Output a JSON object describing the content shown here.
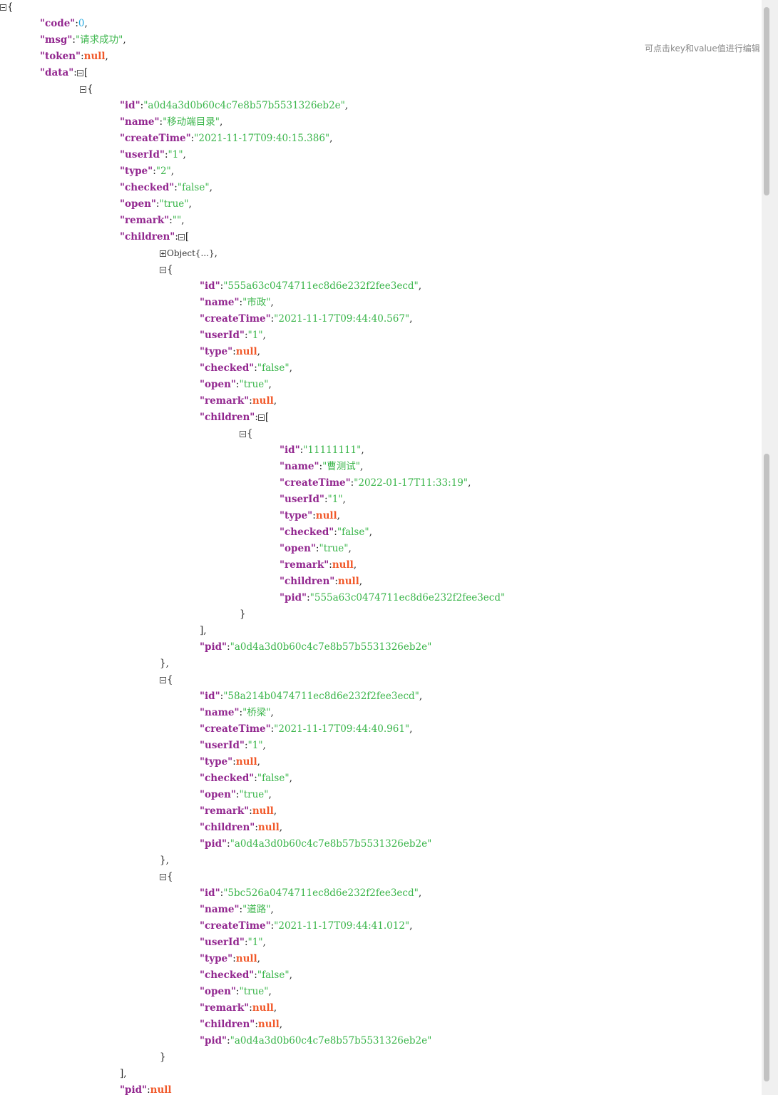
{
  "hint": "可点击key和value值进行编辑",
  "collapsed_label": "Object{...}",
  "lines": [
    {
      "indent": 0,
      "tog": "minus",
      "parts": [
        [
          "p",
          "{"
        ]
      ]
    },
    {
      "indent": 1,
      "parts": [
        [
          "k",
          "\"code\""
        ],
        [
          "p",
          ":"
        ],
        [
          "n",
          "0"
        ],
        [
          "p",
          ","
        ]
      ]
    },
    {
      "indent": 1,
      "parts": [
        [
          "k",
          "\"msg\""
        ],
        [
          "p",
          ":"
        ],
        [
          "s",
          "\"请求成功\""
        ],
        [
          "p",
          ","
        ]
      ]
    },
    {
      "indent": 1,
      "parts": [
        [
          "k",
          "\"token\""
        ],
        [
          "p",
          ":"
        ],
        [
          "nl",
          "null"
        ],
        [
          "p",
          ","
        ]
      ]
    },
    {
      "indent": 1,
      "parts": [
        [
          "k",
          "\"data\""
        ],
        [
          "p",
          ":"
        ],
        [
          "tog",
          "minus"
        ],
        [
          "p",
          "["
        ]
      ]
    },
    {
      "indent": 2,
      "parts": [
        [
          "tog",
          "minus"
        ],
        [
          "p",
          "{"
        ]
      ]
    },
    {
      "indent": 3,
      "parts": [
        [
          "k",
          "\"id\""
        ],
        [
          "p",
          ":"
        ],
        [
          "s",
          "\"a0d4a3d0b60c4c7e8b57b5531326eb2e\""
        ],
        [
          "p",
          ","
        ]
      ]
    },
    {
      "indent": 3,
      "parts": [
        [
          "k",
          "\"name\""
        ],
        [
          "p",
          ":"
        ],
        [
          "s",
          "\"移动端目录\""
        ],
        [
          "p",
          ","
        ]
      ]
    },
    {
      "indent": 3,
      "parts": [
        [
          "k",
          "\"createTime\""
        ],
        [
          "p",
          ":"
        ],
        [
          "s",
          "\"2021-11-17T09:40:15.386\""
        ],
        [
          "p",
          ","
        ]
      ]
    },
    {
      "indent": 3,
      "parts": [
        [
          "k",
          "\"userId\""
        ],
        [
          "p",
          ":"
        ],
        [
          "s",
          "\"1\""
        ],
        [
          "p",
          ","
        ]
      ]
    },
    {
      "indent": 3,
      "parts": [
        [
          "k",
          "\"type\""
        ],
        [
          "p",
          ":"
        ],
        [
          "s",
          "\"2\""
        ],
        [
          "p",
          ","
        ]
      ]
    },
    {
      "indent": 3,
      "parts": [
        [
          "k",
          "\"checked\""
        ],
        [
          "p",
          ":"
        ],
        [
          "s",
          "\"false\""
        ],
        [
          "p",
          ","
        ]
      ]
    },
    {
      "indent": 3,
      "parts": [
        [
          "k",
          "\"open\""
        ],
        [
          "p",
          ":"
        ],
        [
          "s",
          "\"true\""
        ],
        [
          "p",
          ","
        ]
      ]
    },
    {
      "indent": 3,
      "parts": [
        [
          "k",
          "\"remark\""
        ],
        [
          "p",
          ":"
        ],
        [
          "s",
          "\"\""
        ],
        [
          "p",
          ","
        ]
      ]
    },
    {
      "indent": 3,
      "parts": [
        [
          "k",
          "\"children\""
        ],
        [
          "p",
          ":"
        ],
        [
          "tog",
          "minus"
        ],
        [
          "p",
          "["
        ]
      ]
    },
    {
      "indent": 4,
      "parts": [
        [
          "tog",
          "plus"
        ],
        [
          "c",
          "Object{...}"
        ],
        [
          "p",
          ","
        ]
      ]
    },
    {
      "indent": 4,
      "parts": [
        [
          "tog",
          "minus"
        ],
        [
          "p",
          "{"
        ]
      ]
    },
    {
      "indent": 5,
      "parts": [
        [
          "k",
          "\"id\""
        ],
        [
          "p",
          ":"
        ],
        [
          "s",
          "\"555a63c0474711ec8d6e232f2fee3ecd\""
        ],
        [
          "p",
          ","
        ]
      ]
    },
    {
      "indent": 5,
      "parts": [
        [
          "k",
          "\"name\""
        ],
        [
          "p",
          ":"
        ],
        [
          "s",
          "\"市政\""
        ],
        [
          "p",
          ","
        ]
      ]
    },
    {
      "indent": 5,
      "parts": [
        [
          "k",
          "\"createTime\""
        ],
        [
          "p",
          ":"
        ],
        [
          "s",
          "\"2021-11-17T09:44:40.567\""
        ],
        [
          "p",
          ","
        ]
      ]
    },
    {
      "indent": 5,
      "parts": [
        [
          "k",
          "\"userId\""
        ],
        [
          "p",
          ":"
        ],
        [
          "s",
          "\"1\""
        ],
        [
          "p",
          ","
        ]
      ]
    },
    {
      "indent": 5,
      "parts": [
        [
          "k",
          "\"type\""
        ],
        [
          "p",
          ":"
        ],
        [
          "nl",
          "null"
        ],
        [
          "p",
          ","
        ]
      ]
    },
    {
      "indent": 5,
      "parts": [
        [
          "k",
          "\"checked\""
        ],
        [
          "p",
          ":"
        ],
        [
          "s",
          "\"false\""
        ],
        [
          "p",
          ","
        ]
      ]
    },
    {
      "indent": 5,
      "parts": [
        [
          "k",
          "\"open\""
        ],
        [
          "p",
          ":"
        ],
        [
          "s",
          "\"true\""
        ],
        [
          "p",
          ","
        ]
      ]
    },
    {
      "indent": 5,
      "parts": [
        [
          "k",
          "\"remark\""
        ],
        [
          "p",
          ":"
        ],
        [
          "nl",
          "null"
        ],
        [
          "p",
          ","
        ]
      ]
    },
    {
      "indent": 5,
      "parts": [
        [
          "k",
          "\"children\""
        ],
        [
          "p",
          ":"
        ],
        [
          "tog",
          "minus"
        ],
        [
          "p",
          "["
        ]
      ]
    },
    {
      "indent": 6,
      "parts": [
        [
          "tog",
          "minus"
        ],
        [
          "p",
          "{"
        ]
      ]
    },
    {
      "indent": 7,
      "parts": [
        [
          "k",
          "\"id\""
        ],
        [
          "p",
          ":"
        ],
        [
          "s",
          "\"11111111\""
        ],
        [
          "p",
          ","
        ]
      ]
    },
    {
      "indent": 7,
      "parts": [
        [
          "k",
          "\"name\""
        ],
        [
          "p",
          ":"
        ],
        [
          "s",
          "\"曹测试\""
        ],
        [
          "p",
          ","
        ]
      ]
    },
    {
      "indent": 7,
      "parts": [
        [
          "k",
          "\"createTime\""
        ],
        [
          "p",
          ":"
        ],
        [
          "s",
          "\"2022-01-17T11:33:19\""
        ],
        [
          "p",
          ","
        ]
      ]
    },
    {
      "indent": 7,
      "parts": [
        [
          "k",
          "\"userId\""
        ],
        [
          "p",
          ":"
        ],
        [
          "s",
          "\"1\""
        ],
        [
          "p",
          ","
        ]
      ]
    },
    {
      "indent": 7,
      "parts": [
        [
          "k",
          "\"type\""
        ],
        [
          "p",
          ":"
        ],
        [
          "nl",
          "null"
        ],
        [
          "p",
          ","
        ]
      ]
    },
    {
      "indent": 7,
      "parts": [
        [
          "k",
          "\"checked\""
        ],
        [
          "p",
          ":"
        ],
        [
          "s",
          "\"false\""
        ],
        [
          "p",
          ","
        ]
      ]
    },
    {
      "indent": 7,
      "parts": [
        [
          "k",
          "\"open\""
        ],
        [
          "p",
          ":"
        ],
        [
          "s",
          "\"true\""
        ],
        [
          "p",
          ","
        ]
      ]
    },
    {
      "indent": 7,
      "parts": [
        [
          "k",
          "\"remark\""
        ],
        [
          "p",
          ":"
        ],
        [
          "nl",
          "null"
        ],
        [
          "p",
          ","
        ]
      ]
    },
    {
      "indent": 7,
      "parts": [
        [
          "k",
          "\"children\""
        ],
        [
          "p",
          ":"
        ],
        [
          "nl",
          "null"
        ],
        [
          "p",
          ","
        ]
      ]
    },
    {
      "indent": 7,
      "parts": [
        [
          "k",
          "\"pid\""
        ],
        [
          "p",
          ":"
        ],
        [
          "s",
          "\"555a63c0474711ec8d6e232f2fee3ecd\""
        ]
      ]
    },
    {
      "indent": 6,
      "parts": [
        [
          "p",
          "}"
        ]
      ]
    },
    {
      "indent": 5,
      "parts": [
        [
          "p",
          "],"
        ]
      ]
    },
    {
      "indent": 5,
      "parts": [
        [
          "k",
          "\"pid\""
        ],
        [
          "p",
          ":"
        ],
        [
          "s",
          "\"a0d4a3d0b60c4c7e8b57b5531326eb2e\""
        ]
      ]
    },
    {
      "indent": 4,
      "parts": [
        [
          "p",
          "},"
        ]
      ]
    },
    {
      "indent": 4,
      "parts": [
        [
          "tog",
          "minus"
        ],
        [
          "p",
          "{"
        ]
      ]
    },
    {
      "indent": 5,
      "parts": [
        [
          "k",
          "\"id\""
        ],
        [
          "p",
          ":"
        ],
        [
          "s",
          "\"58a214b0474711ec8d6e232f2fee3ecd\""
        ],
        [
          "p",
          ","
        ]
      ]
    },
    {
      "indent": 5,
      "parts": [
        [
          "k",
          "\"name\""
        ],
        [
          "p",
          ":"
        ],
        [
          "s",
          "\"桥梁\""
        ],
        [
          "p",
          ","
        ]
      ]
    },
    {
      "indent": 5,
      "parts": [
        [
          "k",
          "\"createTime\""
        ],
        [
          "p",
          ":"
        ],
        [
          "s",
          "\"2021-11-17T09:44:40.961\""
        ],
        [
          "p",
          ","
        ]
      ]
    },
    {
      "indent": 5,
      "parts": [
        [
          "k",
          "\"userId\""
        ],
        [
          "p",
          ":"
        ],
        [
          "s",
          "\"1\""
        ],
        [
          "p",
          ","
        ]
      ]
    },
    {
      "indent": 5,
      "parts": [
        [
          "k",
          "\"type\""
        ],
        [
          "p",
          ":"
        ],
        [
          "nl",
          "null"
        ],
        [
          "p",
          ","
        ]
      ]
    },
    {
      "indent": 5,
      "parts": [
        [
          "k",
          "\"checked\""
        ],
        [
          "p",
          ":"
        ],
        [
          "s",
          "\"false\""
        ],
        [
          "p",
          ","
        ]
      ]
    },
    {
      "indent": 5,
      "parts": [
        [
          "k",
          "\"open\""
        ],
        [
          "p",
          ":"
        ],
        [
          "s",
          "\"true\""
        ],
        [
          "p",
          ","
        ]
      ]
    },
    {
      "indent": 5,
      "parts": [
        [
          "k",
          "\"remark\""
        ],
        [
          "p",
          ":"
        ],
        [
          "nl",
          "null"
        ],
        [
          "p",
          ","
        ]
      ]
    },
    {
      "indent": 5,
      "parts": [
        [
          "k",
          "\"children\""
        ],
        [
          "p",
          ":"
        ],
        [
          "nl",
          "null"
        ],
        [
          "p",
          ","
        ]
      ]
    },
    {
      "indent": 5,
      "parts": [
        [
          "k",
          "\"pid\""
        ],
        [
          "p",
          ":"
        ],
        [
          "s",
          "\"a0d4a3d0b60c4c7e8b57b5531326eb2e\""
        ]
      ]
    },
    {
      "indent": 4,
      "parts": [
        [
          "p",
          "},"
        ]
      ]
    },
    {
      "indent": 4,
      "parts": [
        [
          "tog",
          "minus"
        ],
        [
          "p",
          "{"
        ]
      ]
    },
    {
      "indent": 5,
      "parts": [
        [
          "k",
          "\"id\""
        ],
        [
          "p",
          ":"
        ],
        [
          "s",
          "\"5bc526a0474711ec8d6e232f2fee3ecd\""
        ],
        [
          "p",
          ","
        ]
      ]
    },
    {
      "indent": 5,
      "parts": [
        [
          "k",
          "\"name\""
        ],
        [
          "p",
          ":"
        ],
        [
          "s",
          "\"道路\""
        ],
        [
          "p",
          ","
        ]
      ]
    },
    {
      "indent": 5,
      "parts": [
        [
          "k",
          "\"createTime\""
        ],
        [
          "p",
          ":"
        ],
        [
          "s",
          "\"2021-11-17T09:44:41.012\""
        ],
        [
          "p",
          ","
        ]
      ]
    },
    {
      "indent": 5,
      "parts": [
        [
          "k",
          "\"userId\""
        ],
        [
          "p",
          ":"
        ],
        [
          "s",
          "\"1\""
        ],
        [
          "p",
          ","
        ]
      ]
    },
    {
      "indent": 5,
      "parts": [
        [
          "k",
          "\"type\""
        ],
        [
          "p",
          ":"
        ],
        [
          "nl",
          "null"
        ],
        [
          "p",
          ","
        ]
      ]
    },
    {
      "indent": 5,
      "parts": [
        [
          "k",
          "\"checked\""
        ],
        [
          "p",
          ":"
        ],
        [
          "s",
          "\"false\""
        ],
        [
          "p",
          ","
        ]
      ]
    },
    {
      "indent": 5,
      "parts": [
        [
          "k",
          "\"open\""
        ],
        [
          "p",
          ":"
        ],
        [
          "s",
          "\"true\""
        ],
        [
          "p",
          ","
        ]
      ]
    },
    {
      "indent": 5,
      "parts": [
        [
          "k",
          "\"remark\""
        ],
        [
          "p",
          ":"
        ],
        [
          "nl",
          "null"
        ],
        [
          "p",
          ","
        ]
      ]
    },
    {
      "indent": 5,
      "parts": [
        [
          "k",
          "\"children\""
        ],
        [
          "p",
          ":"
        ],
        [
          "nl",
          "null"
        ],
        [
          "p",
          ","
        ]
      ]
    },
    {
      "indent": 5,
      "parts": [
        [
          "k",
          "\"pid\""
        ],
        [
          "p",
          ":"
        ],
        [
          "s",
          "\"a0d4a3d0b60c4c7e8b57b5531326eb2e\""
        ]
      ]
    },
    {
      "indent": 4,
      "parts": [
        [
          "p",
          "}"
        ]
      ]
    },
    {
      "indent": 3,
      "parts": [
        [
          "p",
          "],"
        ]
      ]
    },
    {
      "indent": 3,
      "parts": [
        [
          "k",
          "\"pid\""
        ],
        [
          "p",
          ":"
        ],
        [
          "nl",
          "null"
        ]
      ]
    }
  ]
}
